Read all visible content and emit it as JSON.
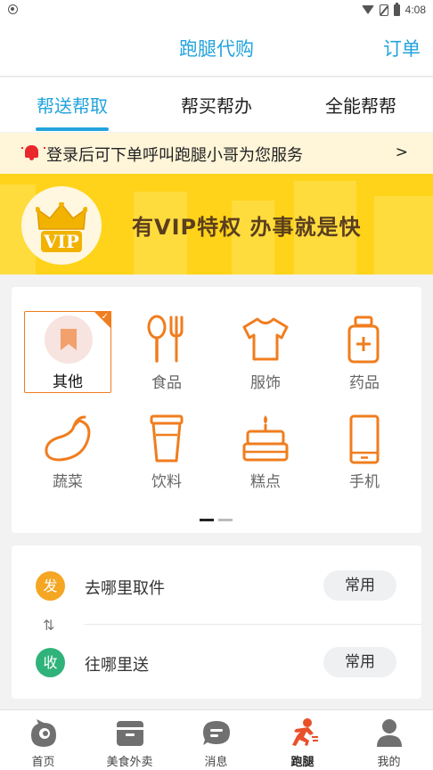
{
  "status_bar": {
    "time": "4:08"
  },
  "header": {
    "title": "跑腿代购",
    "order_label": "订单"
  },
  "tabs": [
    {
      "label": "帮送帮取",
      "active": true
    },
    {
      "label": "帮买帮办",
      "active": false
    },
    {
      "label": "全能帮帮",
      "active": false
    }
  ],
  "notice": {
    "text": "登录后可下单呼叫跑腿小哥为您服务",
    "arrow": ">"
  },
  "vip_banner": {
    "badge": "VIP",
    "slogan": "有VIP特权  办事就是快"
  },
  "categories": [
    {
      "label": "其他",
      "icon": "bookmark-icon",
      "selected": true
    },
    {
      "label": "食品",
      "icon": "utensils-icon",
      "selected": false
    },
    {
      "label": "服饰",
      "icon": "shirt-icon",
      "selected": false
    },
    {
      "label": "药品",
      "icon": "medicine-bottle-icon",
      "selected": false
    },
    {
      "label": "蔬菜",
      "icon": "eggplant-icon",
      "selected": false
    },
    {
      "label": "饮料",
      "icon": "cup-icon",
      "selected": false
    },
    {
      "label": "糕点",
      "icon": "cake-icon",
      "selected": false
    },
    {
      "label": "手机",
      "icon": "phone-icon",
      "selected": false
    }
  ],
  "pager": {
    "pages": 2,
    "current": 1
  },
  "address": {
    "pickup": {
      "badge": "发",
      "text": "去哪里取件",
      "button": "常用"
    },
    "deliver": {
      "badge": "收",
      "text": "往哪里送",
      "button": "常用"
    }
  },
  "bottom_nav": [
    {
      "label": "首页",
      "icon": "home-icon",
      "active": false
    },
    {
      "label": "美食外卖",
      "icon": "food-box-icon",
      "active": false
    },
    {
      "label": "消息",
      "icon": "message-icon",
      "active": false
    },
    {
      "label": "跑腿",
      "icon": "runner-icon",
      "active": true
    },
    {
      "label": "我的",
      "icon": "profile-icon",
      "active": false
    }
  ],
  "colors": {
    "primary": "#23a3dc",
    "accent": "#f07d1e",
    "notice_bg": "#fff5d9",
    "banner": "#ffd31a",
    "badge_send": "#f5a623",
    "badge_receive": "#2fb37a"
  }
}
